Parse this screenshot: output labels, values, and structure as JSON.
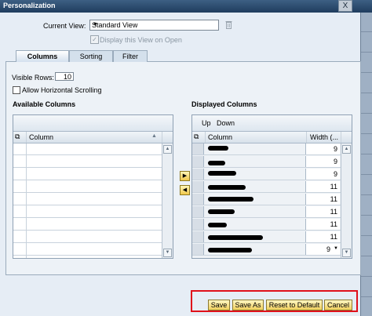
{
  "window": {
    "title": "Personalization",
    "close_glyph": "X"
  },
  "current_view": {
    "label": "Current View:",
    "value": "Standard View",
    "display_on_open": "Display this View on Open"
  },
  "tabs": [
    {
      "label": "Columns"
    },
    {
      "label": "Sorting"
    },
    {
      "label": "Filter"
    }
  ],
  "options": {
    "visible_rows_label": "Visible Rows:",
    "visible_rows_value": "10",
    "horizontal_scroll_label": "Allow Horizontal Scrolling"
  },
  "available": {
    "title": "Available Columns",
    "column_header": "Column"
  },
  "displayed": {
    "title": "Displayed Columns",
    "up_label": "Up",
    "down_label": "Down",
    "column_header": "Column",
    "width_header": "Width (...",
    "widths": [
      "9",
      "9",
      "9",
      "11",
      "11",
      "11",
      "11",
      "11",
      "9"
    ]
  },
  "footer": {
    "save": "Save",
    "save_as": "Save As",
    "reset": "Reset to Default",
    "cancel": "Cancel"
  },
  "colors": {
    "title_bar": "#1f3d5e",
    "highlight_border": "#e0101a",
    "button_fill": "#f1cf5c"
  }
}
